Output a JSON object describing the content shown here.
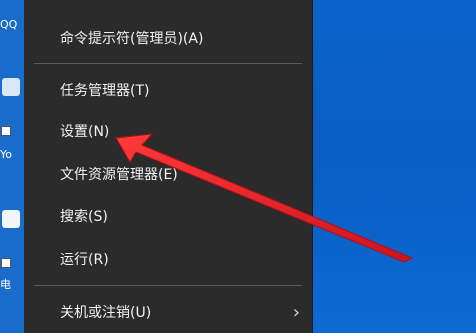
{
  "menu": {
    "items": [
      {
        "label": "命令提示符(管理员)(A)"
      },
      {
        "label": "任务管理器(T)"
      },
      {
        "label": "设置(N)"
      },
      {
        "label": "文件资源管理器(E)"
      },
      {
        "label": "搜索(S)"
      },
      {
        "label": "运行(R)"
      },
      {
        "label": "关机或注销(U)"
      }
    ],
    "submenu_indicator": "›"
  },
  "desktop": {
    "partial_labels": [
      "QQ",
      "Yo",
      "电"
    ]
  },
  "colors": {
    "menu_bg": "#2b2b2b",
    "menu_text": "#f2f2f2",
    "desktop_blue": "#0a62c8",
    "annotation_red": "#e0202a"
  }
}
